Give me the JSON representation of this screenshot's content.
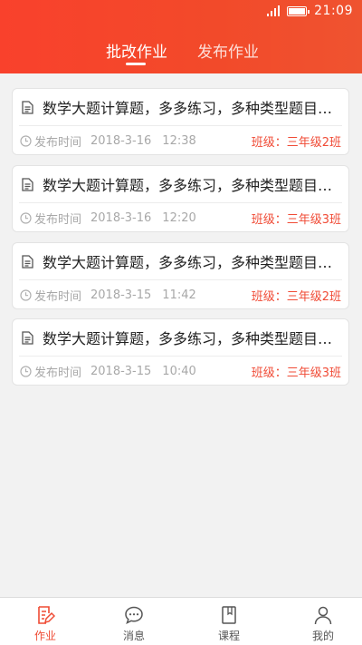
{
  "status_bar": {
    "time": "21:09"
  },
  "header": {
    "tabs": [
      {
        "label": "批改作业",
        "active": true
      },
      {
        "label": "发布作业",
        "active": false
      }
    ]
  },
  "homework_list": [
    {
      "title": "数学大题计算题，多多练习，多种类型题目…",
      "time_label": "发布时间",
      "date": "2018-3-16",
      "time": "12:38",
      "class": "班级：三年级2班"
    },
    {
      "title": "数学大题计算题，多多练习，多种类型题目…",
      "time_label": "发布时间",
      "date": "2018-3-16",
      "time": "12:20",
      "class": "班级：三年级3班"
    },
    {
      "title": "数学大题计算题，多多练习，多种类型题目…",
      "time_label": "发布时间",
      "date": "2018-3-15",
      "time": "11:42",
      "class": "班级：三年级2班"
    },
    {
      "title": "数学大题计算题，多多练习，多种类型题目…",
      "time_label": "发布时间",
      "date": "2018-3-15",
      "time": "10:40",
      "class": "班级：三年级3班"
    }
  ],
  "bottom_nav": [
    {
      "label": "作业",
      "icon": "homework-icon",
      "active": true
    },
    {
      "label": "消息",
      "icon": "message-icon",
      "active": false
    },
    {
      "label": "课程",
      "icon": "book-icon",
      "active": false
    },
    {
      "label": "我的",
      "icon": "user-icon",
      "active": false
    }
  ],
  "colors": {
    "accent": "#f24a2a",
    "class_text": "#f04b36",
    "meta_text": "#a8a8a8"
  }
}
